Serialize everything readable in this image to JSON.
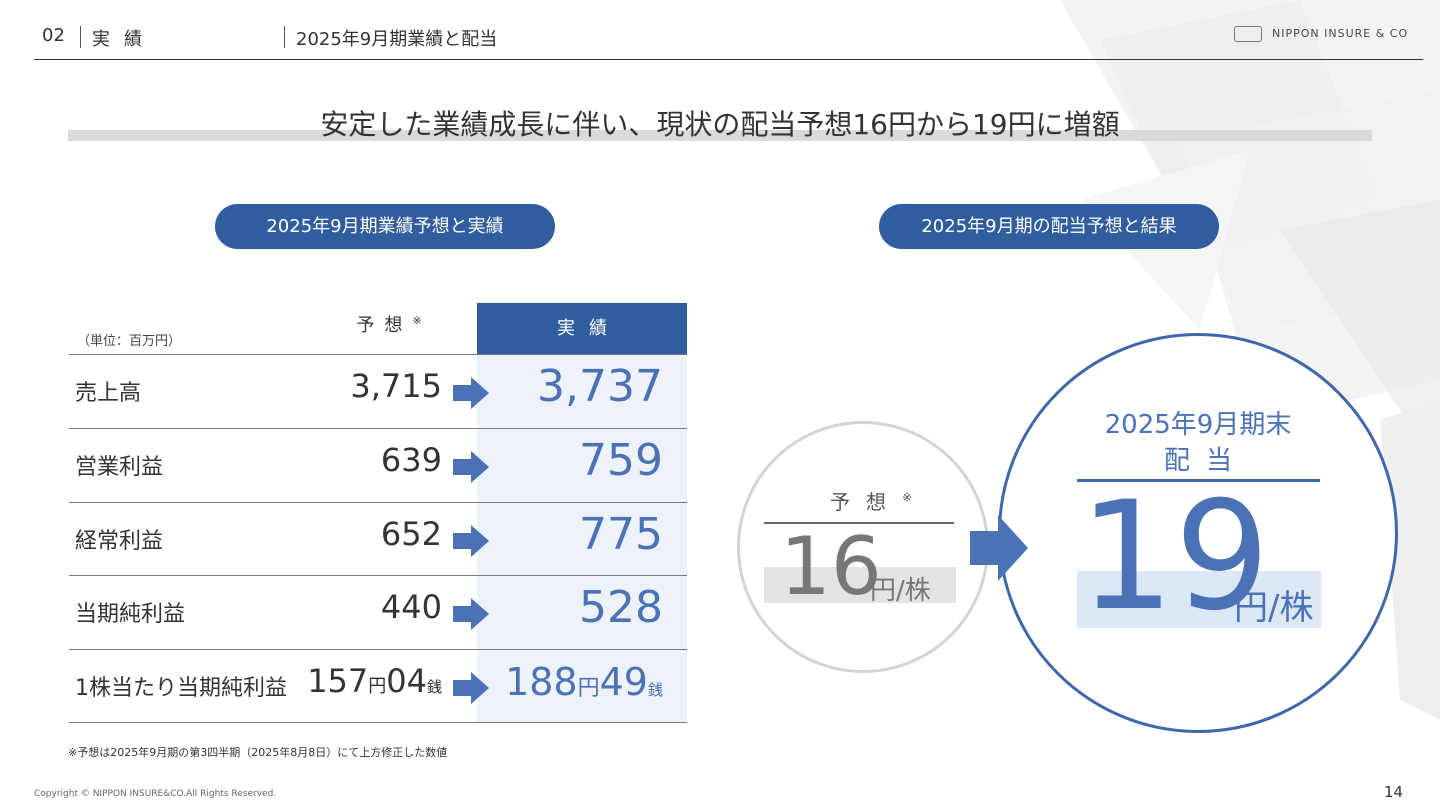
{
  "header": {
    "section_number": "02",
    "section_title": "実績",
    "page_title": "2025年9月期業績と配当",
    "logo_text": "NIPPON INSURE & CO"
  },
  "headline": "安定した業績成長に伴い、現状の配当予想16円から19円に増額",
  "left_panel": {
    "pill": "2025年9月期業績予想と実績",
    "unit": "（単位：百万円）",
    "forecast_header": "予想",
    "forecast_mark": "※",
    "actual_header": "実績",
    "rows": [
      {
        "label": "売上高",
        "forecast": "3,715",
        "actual": "3,737"
      },
      {
        "label": "営業利益",
        "forecast": "639",
        "actual": "759"
      },
      {
        "label": "経常利益",
        "forecast": "652",
        "actual": "775"
      },
      {
        "label": "当期純利益",
        "forecast": "440",
        "actual": "528"
      }
    ],
    "eps_row": {
      "label": "1株当たり当期純利益",
      "forecast_yen": "157",
      "forecast_sen": "04",
      "actual_yen": "188",
      "actual_sen": "49",
      "yen_unit": "円",
      "sen_unit": "銭"
    },
    "footnote": "※予想は2025年9月期の第3四半期（2025年8月8日）にて上方修正した数値"
  },
  "right_panel": {
    "pill": "2025年9月期の配当予想と結果",
    "forecast_label": "予想",
    "forecast_mark": "※",
    "forecast_value": "16",
    "forecast_unit": "円/株",
    "result_title_line1": "2025年9月期末",
    "result_title_line2": "配当",
    "result_value": "19",
    "result_unit": "円/株"
  },
  "footer": {
    "copyright": "Copyright © NIPPON INSURE&CO.All Rights Reserved.",
    "page_number": "14"
  },
  "colors": {
    "accent": "#2f5d9d",
    "value_blue": "#4a72b5",
    "actual_column_bg": "#eef3fa",
    "arrow": "#4a72b5"
  }
}
